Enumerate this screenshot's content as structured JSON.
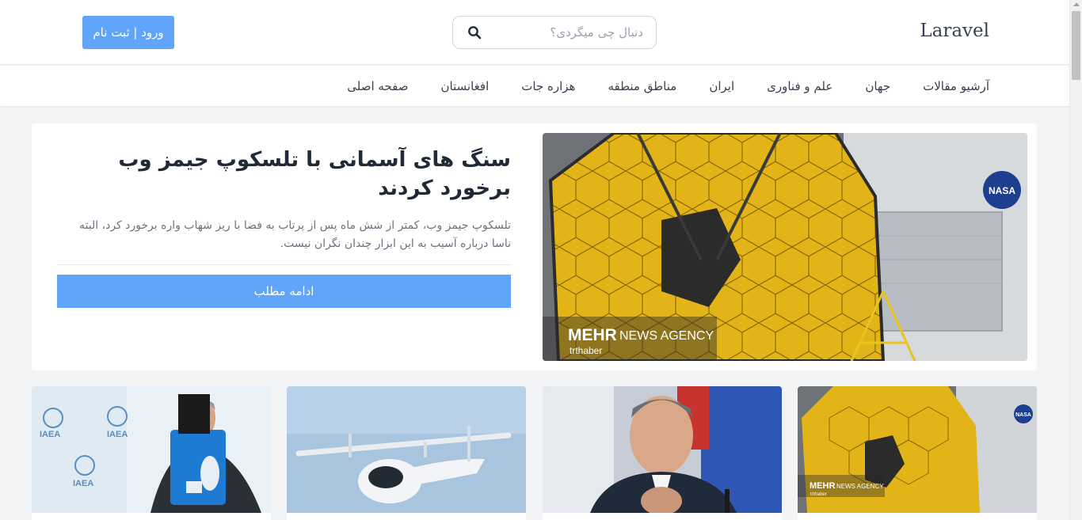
{
  "header": {
    "brand": "Laravel",
    "search": {
      "placeholder": "دنبال چی میگردی؟",
      "value": ""
    },
    "auth_label": "ورود | ثبت نام"
  },
  "nav": {
    "items": [
      {
        "label": "صفحه اصلی"
      },
      {
        "label": "افغانستان"
      },
      {
        "label": "هزاره جات"
      },
      {
        "label": "مناطق منطقه"
      },
      {
        "label": "ایران"
      },
      {
        "label": "علم و فناوری"
      },
      {
        "label": "جهان"
      },
      {
        "label": "آرشیو مقالات"
      }
    ]
  },
  "featured": {
    "title": "سنگ های آسمانی با تلسکوپ جیمز وب برخورد کردند",
    "excerpt": "تلسکوپ جیمز وب، کمتر از شش ماه پس از پرتاب به فضا با ریز شهاب واره برخورد کرد، البته ناسا درباره آسیب به این ابزار چندان نگران نیست.",
    "read_more": "ادامه مطلب",
    "image": {
      "watermark_brand": "MEHR",
      "watermark_agency": "NEWS AGENCY",
      "watermark_source": "trthaber",
      "badge": "NASA"
    }
  },
  "cards": [
    {
      "image": {
        "watermark_brand": "MEHR",
        "watermark_agency": "NEWS AGENCY",
        "watermark_source": "trthaber",
        "badge": "NASA"
      }
    },
    {
      "image": {}
    },
    {
      "image": {}
    },
    {
      "image": {
        "logo_text": "IAEA"
      }
    }
  ],
  "colors": {
    "accent": "#60a5fa",
    "background": "#f3f4f6",
    "card": "#ffffff",
    "mirror_gold": "#e7b416"
  }
}
